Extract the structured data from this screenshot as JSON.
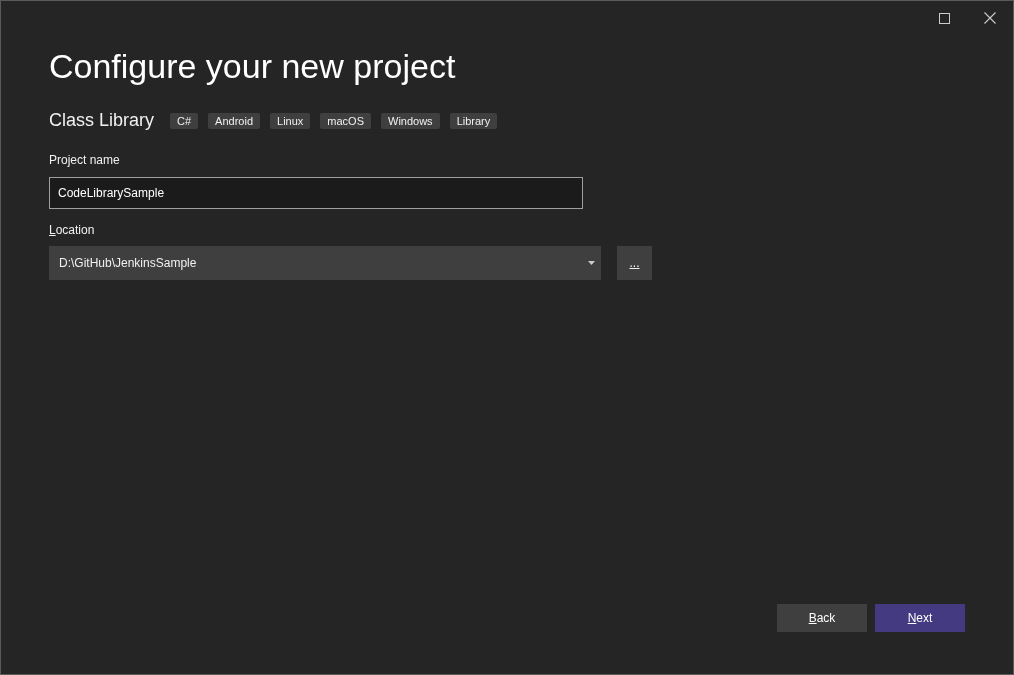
{
  "window": {
    "controls": [
      {
        "kind": "maximize"
      },
      {
        "kind": "close"
      }
    ]
  },
  "title": "Configure your new project",
  "template": {
    "name": "Class Library",
    "tags": [
      "C#",
      "Android",
      "Linux",
      "macOS",
      "Windows",
      "Library"
    ]
  },
  "fields": [
    {
      "kind": "text",
      "label": "Project name",
      "value": "CodeLibrarySample"
    },
    {
      "kind": "dropdown",
      "label": "Location",
      "value": "D:\\GitHub\\JenkinsSample",
      "browse": "..."
    }
  ],
  "buttons": [
    {
      "label": "Back",
      "primary": false
    },
    {
      "label": "Next",
      "primary": true
    }
  ]
}
